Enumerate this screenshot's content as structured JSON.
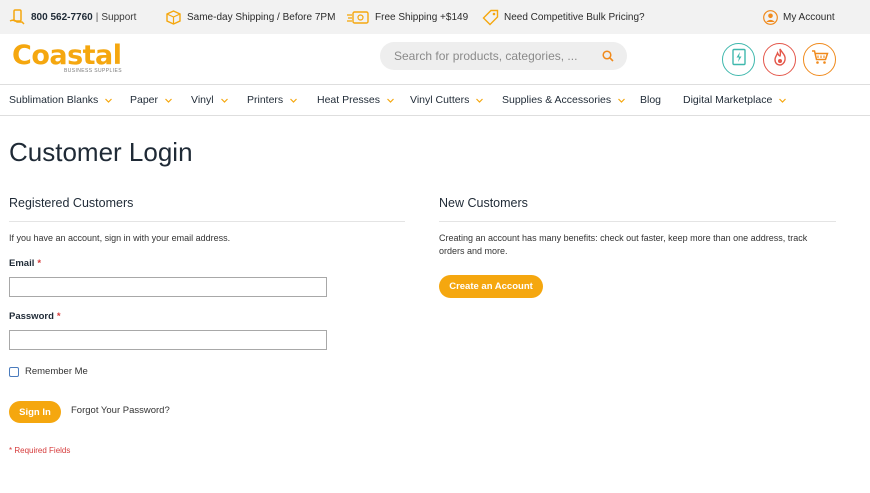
{
  "topbar": {
    "phone": "800 562-7760",
    "separator": "|",
    "support": "Support",
    "shipping_same_day": "Same-day Shipping / Before 7PM",
    "free_shipping": "Free Shipping +$149",
    "bulk_pricing": "Need Competitive Bulk Pricing?",
    "account": "My Account"
  },
  "header": {
    "logo_text": "Coastal",
    "logo_sub": "BUSINESS SUPPLIES",
    "search_placeholder": "Search for products, categories, ..."
  },
  "nav": {
    "items": [
      {
        "label": "Sublimation Blanks",
        "dropdown": true
      },
      {
        "label": "Paper",
        "dropdown": true
      },
      {
        "label": "Vinyl",
        "dropdown": true
      },
      {
        "label": "Printers",
        "dropdown": true
      },
      {
        "label": "Heat Presses",
        "dropdown": true
      },
      {
        "label": "Vinyl Cutters",
        "dropdown": true
      },
      {
        "label": "Supplies & Accessories",
        "dropdown": true
      },
      {
        "label": "Blog",
        "dropdown": false
      },
      {
        "label": "Digital Marketplace",
        "dropdown": true
      }
    ]
  },
  "page": {
    "title": "Customer Login"
  },
  "registered": {
    "title": "Registered Customers",
    "intro": "If you have an account, sign in with your email address.",
    "email_label": "Email",
    "password_label": "Password",
    "required_mark": "*",
    "email_value": "",
    "password_value": "",
    "remember_label": "Remember Me",
    "sign_in_label": "Sign In",
    "forgot_label": "Forgot Your Password?",
    "required_note": "* Required Fields"
  },
  "new_customers": {
    "title": "New Customers",
    "text": "Creating an account has many benefits: check out faster, keep more than one address, track orders and more.",
    "create_label": "Create an Account"
  },
  "colors": {
    "accent": "#f5a70f",
    "text": "#1f2a36",
    "required": "#d63b3b",
    "teal_icon": "#3fb8ad",
    "red_icon": "#e4574a",
    "orange_icon": "#f08a1c"
  }
}
